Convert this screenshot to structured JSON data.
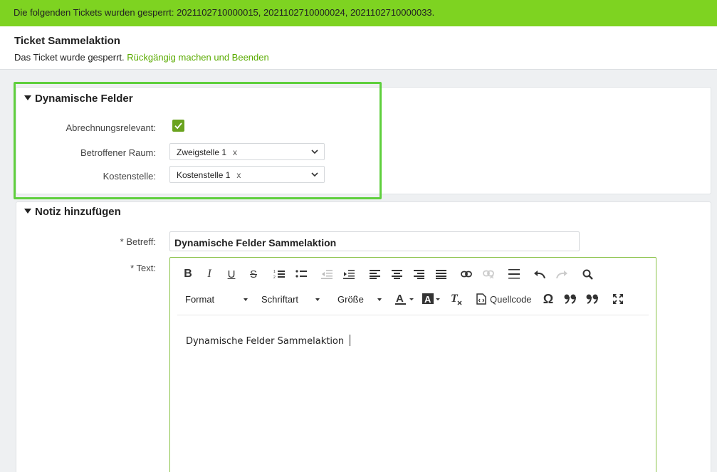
{
  "notice": {
    "text": "Die folgenden Tickets wurden gesperrt: 2021102710000015, 2021102710000024, 2021102710000033."
  },
  "header": {
    "title": "Ticket Sammelaktion",
    "subtitle": "Das Ticket wurde gesperrt.",
    "undo_link": "Rückgängig machen und Beenden"
  },
  "dynamic_fields": {
    "title": "Dynamische Felder",
    "billing_label": "Abrechnungsrelevant:",
    "billing_checked": true,
    "room_label": "Betroffener Raum:",
    "room_value": "Zweigstelle 1",
    "room_remove": "x",
    "cost_label": "Kostenstelle:",
    "cost_value": "Kostenstelle 1",
    "cost_remove": "x"
  },
  "note": {
    "title": "Notiz hinzufügen",
    "subject_label": "* Betreff:",
    "subject_value": "Dynamische Felder Sammelaktion",
    "text_label": "* Text:"
  },
  "editor": {
    "format_label": "Format",
    "font_label": "Schriftart",
    "size_label": "Größe",
    "source_label": "Quellcode",
    "content": "Dynamische Felder Sammelaktion",
    "icons": [
      "bold-icon",
      "italic-icon",
      "underline-icon",
      "strikethrough-icon",
      "numbered-list-icon",
      "bullet-list-icon",
      "outdent-icon",
      "indent-icon",
      "align-left-icon",
      "align-center-icon",
      "align-right-icon",
      "justify-icon",
      "link-icon",
      "unlink-icon",
      "horizontal-rule-icon",
      "undo-icon",
      "redo-icon",
      "find-icon",
      "text-color-icon",
      "background-color-icon",
      "remove-format-icon",
      "source-icon",
      "special-char-icon",
      "blockquote-icon",
      "quote-icon",
      "maximize-icon"
    ]
  },
  "colors": {
    "accent_green": "#7ed321",
    "link_green": "#5aab00",
    "checkbox_green": "#6aa31f",
    "highlight": "#5fcf3d"
  }
}
